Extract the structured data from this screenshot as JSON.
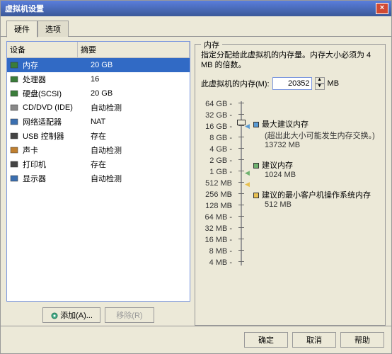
{
  "title": "虚拟机设置",
  "tabs": {
    "hardware": "硬件",
    "options": "选项"
  },
  "columns": {
    "device": "设备",
    "summary": "摘要"
  },
  "devices": [
    {
      "name": "内存",
      "summary": "20 GB",
      "color": "#3b7d3b",
      "sel": true
    },
    {
      "name": "处理器",
      "summary": "16",
      "color": "#3b7d3b"
    },
    {
      "name": "硬盘(SCSI)",
      "summary": "20 GB",
      "color": "#3b7d3b"
    },
    {
      "name": "CD/DVD (IDE)",
      "summary": "自动检测",
      "color": "#888"
    },
    {
      "name": "网络适配器",
      "summary": "NAT",
      "color": "#3b6fb0"
    },
    {
      "name": "USB 控制器",
      "summary": "存在",
      "color": "#444"
    },
    {
      "name": "声卡",
      "summary": "自动检测",
      "color": "#c08030"
    },
    {
      "name": "打印机",
      "summary": "存在",
      "color": "#444"
    },
    {
      "name": "显示器",
      "summary": "自动检测",
      "color": "#3b6fb0"
    }
  ],
  "buttons": {
    "add": "添加(A)...",
    "remove": "移除(R)",
    "ok": "确定",
    "cancel": "取消",
    "help": "帮助"
  },
  "memory": {
    "group": "内存",
    "desc": "指定分配给此虚拟机的内存量。内存大小必须为 4 MB 的倍数。",
    "label": "此虚拟机的内存(M):",
    "value": "20352",
    "unit": "MB",
    "ticks": [
      "64 GB",
      "32 GB",
      "16 GB",
      "8 GB",
      "4 GB",
      "2 GB",
      "1 GB",
      "512 MB",
      "256 MB",
      "128 MB",
      "64 MB",
      "32 MB",
      "16 MB",
      "8 MB",
      "4 MB"
    ],
    "legend": {
      "max": {
        "title": "最大建议内存",
        "note": "(超出此大小可能发生内存交换。)",
        "value": "13732 MB",
        "color": "#5a9bd4"
      },
      "rec": {
        "title": "建议内存",
        "value": "1024 MB",
        "color": "#6fb26f"
      },
      "min": {
        "title": "建议的最小客户机操作系统内存",
        "value": "512 MB",
        "color": "#e8c050"
      }
    }
  }
}
